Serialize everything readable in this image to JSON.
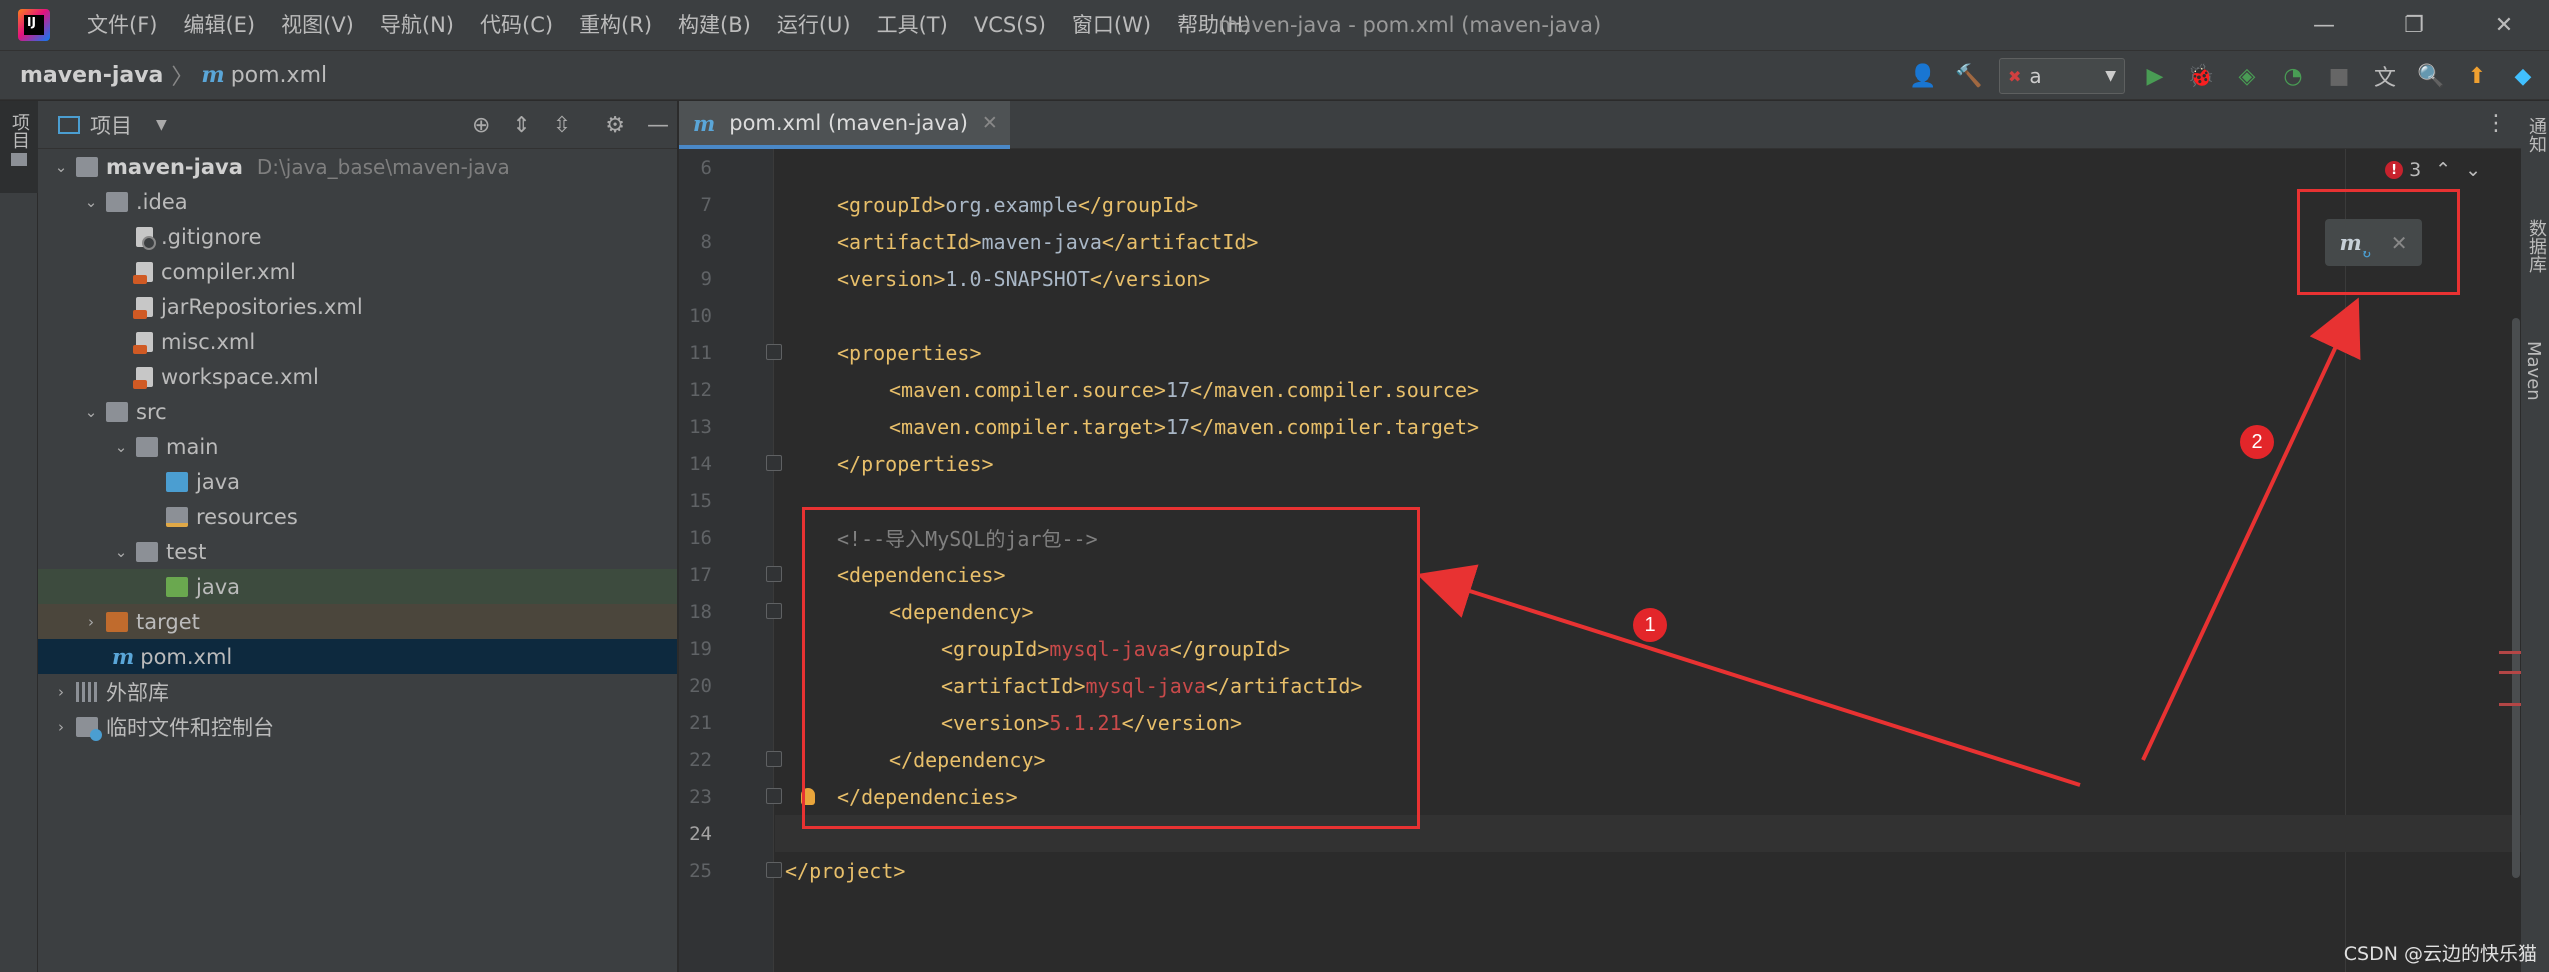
{
  "titlebar": {
    "menu": [
      "文件(F)",
      "编辑(E)",
      "视图(V)",
      "导航(N)",
      "代码(C)",
      "重构(R)",
      "构建(B)",
      "运行(U)",
      "工具(T)",
      "VCS(S)",
      "窗口(W)",
      "帮助(H)"
    ],
    "window_title": "maven-java - pom.xml (maven-java)"
  },
  "navbar": {
    "project": "maven-java",
    "file": "pom.xml",
    "run_config": "a"
  },
  "left_strip": {
    "tab_label": "项目"
  },
  "project_panel": {
    "title": "项目",
    "tree": [
      {
        "label": "maven-java",
        "path": "D:\\java_base\\maven-java"
      },
      {
        "label": ".idea"
      },
      {
        "label": ".gitignore"
      },
      {
        "label": "compiler.xml"
      },
      {
        "label": "jarRepositories.xml"
      },
      {
        "label": "misc.xml"
      },
      {
        "label": "workspace.xml"
      },
      {
        "label": "src"
      },
      {
        "label": "main"
      },
      {
        "label": "java"
      },
      {
        "label": "resources"
      },
      {
        "label": "test"
      },
      {
        "label": "java"
      },
      {
        "label": "target"
      },
      {
        "label": "pom.xml"
      },
      {
        "label": "外部库"
      },
      {
        "label": "临时文件和控制台"
      }
    ]
  },
  "editor": {
    "tab_label": "pom.xml (maven-java)",
    "error_count": "3",
    "line_numbers": [
      "6",
      "7",
      "8",
      "9",
      "10",
      "11",
      "12",
      "13",
      "14",
      "15",
      "16",
      "17",
      "18",
      "19",
      "20",
      "21",
      "22",
      "23",
      "24",
      "25"
    ],
    "lines": {
      "groupId_value": "org.example",
      "artifactId_value": "maven-java",
      "version_value": "1.0-SNAPSHOT",
      "source_value": "17",
      "target_value": "17",
      "comment": "<!--导入MySQL的jar包-->",
      "dep_groupId": "mysql-java",
      "dep_artifactId": "mysql-java",
      "dep_version": "5.1.21"
    }
  },
  "right_strip": {
    "labels": [
      "通知",
      "数据库",
      "Maven"
    ]
  },
  "annotations": {
    "badge1": "1",
    "badge2": "2"
  },
  "watermark": "CSDN @云边的快乐猫",
  "colors": {
    "tag": "#e8bf6a",
    "error_value": "#c94a4a",
    "annotation": "#e83232",
    "selection": "#0d293e"
  }
}
